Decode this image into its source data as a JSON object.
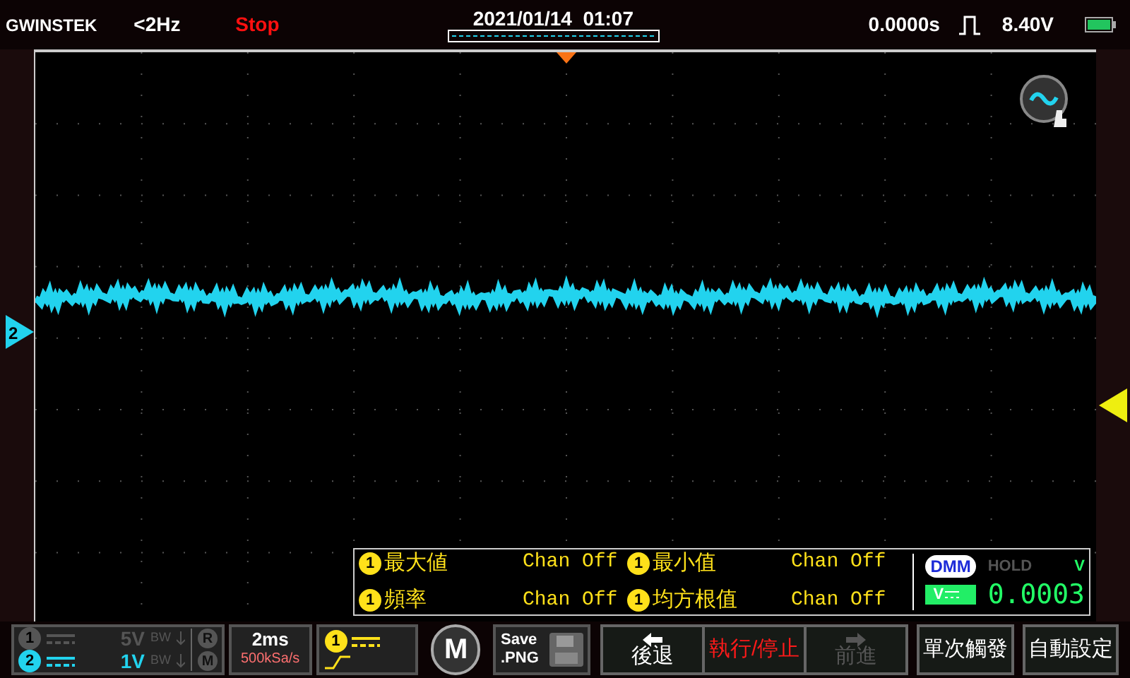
{
  "status_bar": {
    "brand": "GWINSTEK",
    "frequency": "<2Hz",
    "run_state": "Stop",
    "datetime": "2021/01/14  01:07",
    "trigger_time": "0.0000s",
    "trigger_level": "8.40V"
  },
  "plot": {
    "channel_marker": "2"
  },
  "measurements": [
    {
      "channel": "1",
      "name": "最大値",
      "value": "Chan Off"
    },
    {
      "channel": "1",
      "name": "最小值",
      "value": "Chan Off"
    },
    {
      "channel": "1",
      "name": "頻率",
      "value": "Chan Off"
    },
    {
      "channel": "1",
      "name": "均方根值",
      "value": "Chan Off"
    }
  ],
  "dmm": {
    "label": "DMM",
    "mode": "V",
    "hold": "HOLD",
    "hold_on": false,
    "unit": "V",
    "reading": "0.0003"
  },
  "channels": [
    {
      "number": "1",
      "scale": "5V",
      "bw": "BW",
      "on": false
    },
    {
      "number": "2",
      "scale": "1V",
      "bw": "BW",
      "on": true
    }
  ],
  "side_buttons": [
    "R",
    "M"
  ],
  "timebase": {
    "scale": "2ms",
    "sample_rate": "500kSa/s"
  },
  "trigger": {
    "source": "1"
  },
  "menu_button": "M",
  "save": {
    "label": "Save",
    "format": ".PNG"
  },
  "buttons": [
    {
      "kind": "back",
      "label": "後退",
      "disabled": false
    },
    {
      "kind": "run",
      "label": "執行/停止",
      "disabled": false
    },
    {
      "kind": "forward",
      "label": "前進",
      "disabled": true
    },
    {
      "kind": "plain",
      "label": "單次觸發",
      "disabled": false
    },
    {
      "kind": "plain",
      "label": "自動設定",
      "disabled": false
    }
  ]
}
